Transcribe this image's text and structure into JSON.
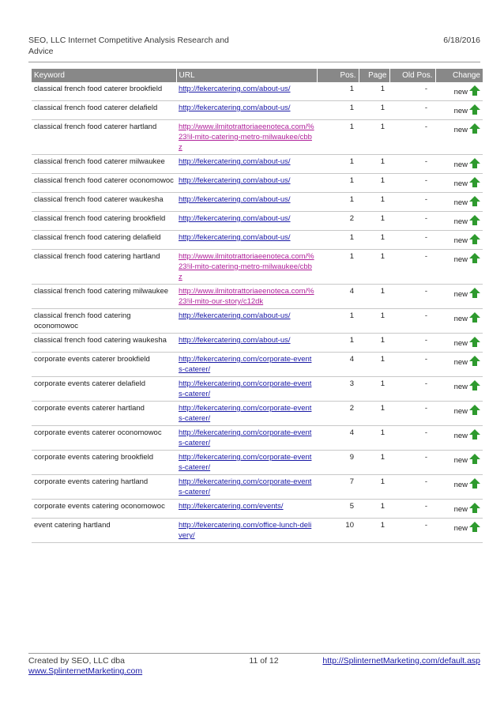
{
  "header": {
    "title": "SEO, LLC Internet Competitive Analysis Research and Advice",
    "date": "6/18/2016"
  },
  "table": {
    "columns": [
      "Keyword",
      "URL",
      "Pos.",
      "Page",
      "Old Pos.",
      "Change"
    ],
    "rows": [
      {
        "keyword": "classical french food caterer brookfield",
        "url": "http://fekercatering.com/about-us/",
        "pos": "1",
        "page": "1",
        "old_pos": "-",
        "change": "new"
      },
      {
        "keyword": "classical french food caterer delafield",
        "url": "http://fekercatering.com/about-us/",
        "pos": "1",
        "page": "1",
        "old_pos": "-",
        "change": "new"
      },
      {
        "keyword": "classical french food caterer hartland",
        "url": "http://www.ilmitotrattoriaeenoteca.com/%23!il-mito-catering-metro-milwaukee/cbbz",
        "pos": "1",
        "page": "1",
        "old_pos": "-",
        "change": "new"
      },
      {
        "keyword": "classical french food caterer milwaukee",
        "url": "http://fekercatering.com/about-us/",
        "pos": "1",
        "page": "1",
        "old_pos": "-",
        "change": "new"
      },
      {
        "keyword": "classical french food caterer oconomowoc",
        "url": "http://fekercatering.com/about-us/",
        "pos": "1",
        "page": "1",
        "old_pos": "-",
        "change": "new"
      },
      {
        "keyword": "classical french food caterer waukesha",
        "url": "http://fekercatering.com/about-us/",
        "pos": "1",
        "page": "1",
        "old_pos": "-",
        "change": "new"
      },
      {
        "keyword": "classical french food catering brookfield",
        "url": "http://fekercatering.com/about-us/",
        "pos": "2",
        "page": "1",
        "old_pos": "-",
        "change": "new"
      },
      {
        "keyword": "classical french food catering delafield",
        "url": "http://fekercatering.com/about-us/",
        "pos": "1",
        "page": "1",
        "old_pos": "-",
        "change": "new"
      },
      {
        "keyword": "classical french food catering hartland",
        "url": "http://www.ilmitotrattoriaeenoteca.com/%23!il-mito-catering-metro-milwaukee/cbbz",
        "pos": "1",
        "page": "1",
        "old_pos": "-",
        "change": "new"
      },
      {
        "keyword": "classical french food catering milwaukee",
        "url": "http://www.ilmitotrattoriaeenoteca.com/%23!il-mito-our-story/c12dk",
        "pos": "4",
        "page": "1",
        "old_pos": "-",
        "change": "new"
      },
      {
        "keyword": "classical french food catering oconomowoc",
        "url": "http://fekercatering.com/about-us/",
        "pos": "1",
        "page": "1",
        "old_pos": "-",
        "change": "new"
      },
      {
        "keyword": "classical french food catering waukesha",
        "url": "http://fekercatering.com/about-us/",
        "pos": "1",
        "page": "1",
        "old_pos": "-",
        "change": "new"
      },
      {
        "keyword": "corporate events caterer brookfield",
        "url": "http://fekercatering.com/corporate-events-caterer/",
        "pos": "4",
        "page": "1",
        "old_pos": "-",
        "change": "new"
      },
      {
        "keyword": "corporate events caterer delafield",
        "url": "http://fekercatering.com/corporate-events-caterer/",
        "pos": "3",
        "page": "1",
        "old_pos": "-",
        "change": "new"
      },
      {
        "keyword": "corporate events caterer hartland",
        "url": "http://fekercatering.com/corporate-events-caterer/",
        "pos": "2",
        "page": "1",
        "old_pos": "-",
        "change": "new"
      },
      {
        "keyword": "corporate events caterer oconomowoc",
        "url": "http://fekercatering.com/corporate-events-caterer/",
        "pos": "4",
        "page": "1",
        "old_pos": "-",
        "change": "new"
      },
      {
        "keyword": "corporate events catering brookfield",
        "url": "http://fekercatering.com/corporate-events-caterer/",
        "pos": "9",
        "page": "1",
        "old_pos": "-",
        "change": "new"
      },
      {
        "keyword": "corporate events catering hartland",
        "url": "http://fekercatering.com/corporate-events-caterer/",
        "pos": "7",
        "page": "1",
        "old_pos": "-",
        "change": "new"
      },
      {
        "keyword": "corporate events catering oconomowoc",
        "url": "http://fekercatering.com/events/",
        "pos": "5",
        "page": "1",
        "old_pos": "-",
        "change": "new"
      },
      {
        "keyword": "event catering hartland",
        "url": "http://fekercatering.com/office-lunch-delivery/",
        "pos": "10",
        "page": "1",
        "old_pos": "-",
        "change": "new"
      }
    ]
  },
  "footer": {
    "created_by": "Created by SEO, LLC dba",
    "site": "www.SplinternetMarketing.com",
    "page_label": "11 of 12",
    "link": "http://SplinternetMarketing.com/default.asp"
  },
  "colors": {
    "header_bg": "#888888",
    "link": "#1a1aa6",
    "visited_link": "#b0219a",
    "arrow": "#2e9a2e"
  },
  "icons": {
    "change": "green-up-arrow-icon"
  }
}
